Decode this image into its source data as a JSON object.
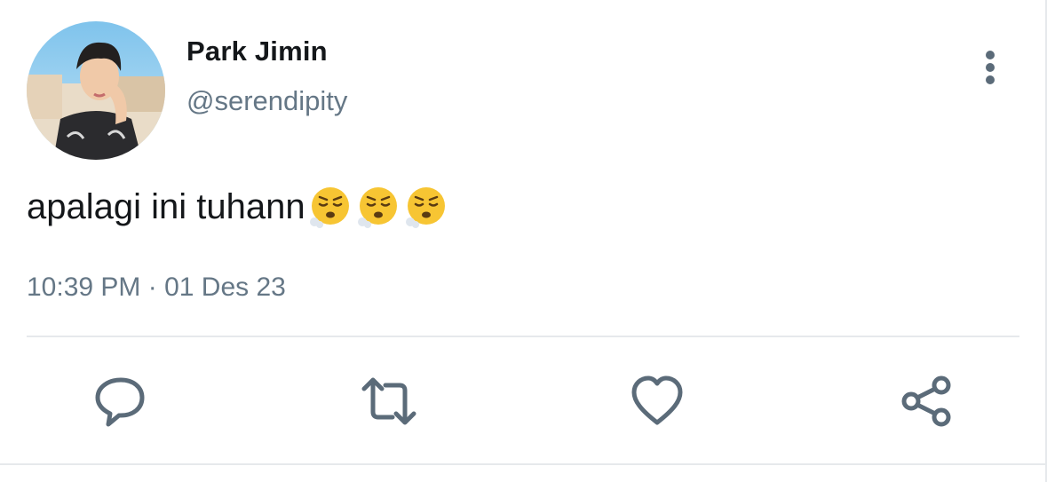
{
  "tweet": {
    "author": {
      "display_name": "Park Jimin",
      "handle": "@serendipity"
    },
    "text": "apalagi ini tuhann",
    "emojis": [
      "face-exhaling",
      "face-exhaling",
      "face-exhaling"
    ],
    "timestamp": "10:39 PM · 01 Des 23"
  },
  "actions": [
    {
      "name": "reply",
      "icon": "comment-icon"
    },
    {
      "name": "retweet",
      "icon": "retweet-icon"
    },
    {
      "name": "like",
      "icon": "heart-icon"
    },
    {
      "name": "share",
      "icon": "share-icon"
    }
  ],
  "colors": {
    "text_primary": "#14171a",
    "text_secondary": "#657786",
    "icon": "#5b6b79",
    "divider": "#e6e9ec"
  }
}
